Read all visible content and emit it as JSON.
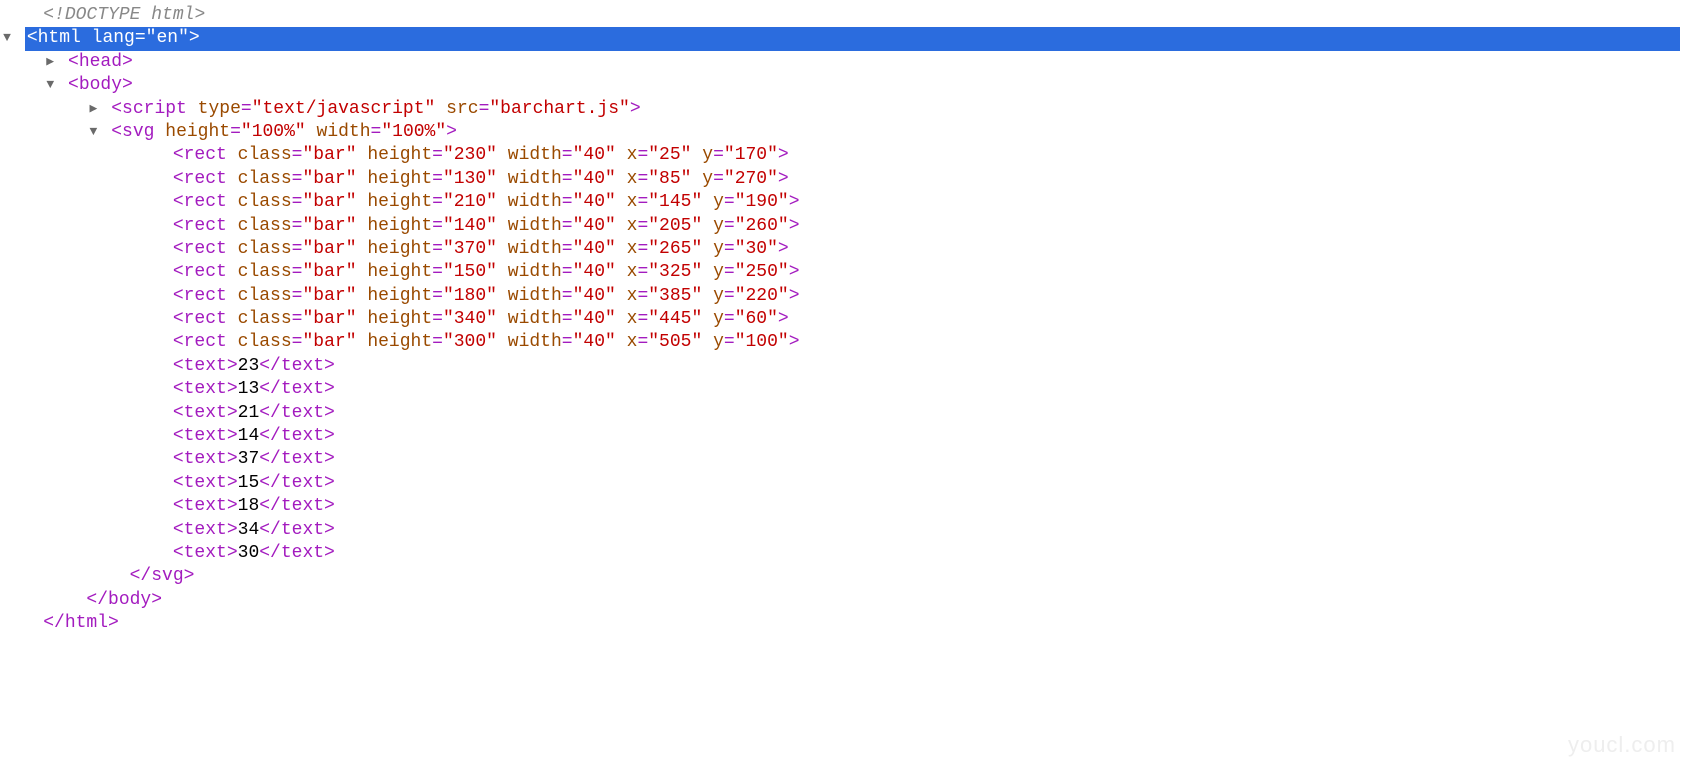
{
  "doctype": "<!DOCTYPE html>",
  "html_tag": {
    "name": "html",
    "attrs": [
      {
        "n": "lang",
        "v": "en"
      }
    ]
  },
  "head_tag": {
    "name": "head"
  },
  "body_tag": {
    "name": "body"
  },
  "script_tag": {
    "name": "script",
    "attrs": [
      {
        "n": "type",
        "v": "text/javascript"
      },
      {
        "n": "src",
        "v": "barchart.js"
      }
    ]
  },
  "svg_tag": {
    "name": "svg",
    "attrs": [
      {
        "n": "height",
        "v": "100%"
      },
      {
        "n": "width",
        "v": "100%"
      }
    ]
  },
  "rects": [
    {
      "height": "230",
      "width": "40",
      "x": "25",
      "y": "170"
    },
    {
      "height": "130",
      "width": "40",
      "x": "85",
      "y": "270"
    },
    {
      "height": "210",
      "width": "40",
      "x": "145",
      "y": "190"
    },
    {
      "height": "140",
      "width": "40",
      "x": "205",
      "y": "260"
    },
    {
      "height": "370",
      "width": "40",
      "x": "265",
      "y": "30"
    },
    {
      "height": "150",
      "width": "40",
      "x": "325",
      "y": "250"
    },
    {
      "height": "180",
      "width": "40",
      "x": "385",
      "y": "220"
    },
    {
      "height": "340",
      "width": "40",
      "x": "445",
      "y": "60"
    },
    {
      "height": "300",
      "width": "40",
      "x": "505",
      "y": "100"
    }
  ],
  "rect_tag": "rect",
  "rect_class": "bar",
  "texts": [
    "23",
    "13",
    "21",
    "14",
    "37",
    "15",
    "18",
    "34",
    "30"
  ],
  "text_tag": "text",
  "close_svg": "</svg>",
  "close_body": "</body>",
  "close_html": "</html>",
  "watermark": "youcl.com",
  "indent_unit": "    "
}
